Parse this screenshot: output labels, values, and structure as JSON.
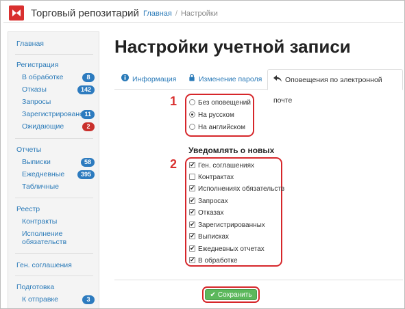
{
  "header": {
    "app_title": "Торговый репозитарий",
    "breadcrumb": [
      {
        "label": "Главная"
      },
      {
        "label": "Настройки"
      }
    ]
  },
  "sidebar": {
    "home": "Главная",
    "registration": "Регистрация",
    "in_processing": {
      "label": "В обработке",
      "count": "8"
    },
    "refusals": {
      "label": "Отказы",
      "count": "142"
    },
    "requests": "Запросы",
    "registered": {
      "label": "Зарегистрировано",
      "count": "11"
    },
    "pending": {
      "label": "Ожидающие",
      "count": "2"
    },
    "reports": "Отчеты",
    "statements": {
      "label": "Выписки",
      "count": "58"
    },
    "daily": {
      "label": "Ежедневные",
      "count": "395"
    },
    "tabular": "Табличные",
    "registry": "Реестр",
    "contracts": "Контракты",
    "execution_line1": "Исполнение",
    "execution_line2": "обязательств",
    "general_agreements": "Ген. соглашения",
    "preparation": "Подготовка",
    "to_send": {
      "label": "К отправке",
      "count": "3"
    }
  },
  "page": {
    "title": "Настройки учетной записи"
  },
  "tabs": [
    {
      "label": "Информация",
      "icon": "info-icon"
    },
    {
      "label": "Изменение пароля",
      "icon": "lock-icon"
    },
    {
      "label": "Оповещения по электронной почте",
      "icon": "reply-arrow-icon",
      "active": true
    }
  ],
  "annotations": {
    "one": "1",
    "two": "2"
  },
  "notification_language": [
    {
      "label": "Без оповещений",
      "selected": false
    },
    {
      "label": "На русском",
      "selected": true
    },
    {
      "label": "На английском",
      "selected": false
    }
  ],
  "notify_heading": "Уведомлять о новых",
  "notify_items": [
    {
      "label": "Ген. соглашениях",
      "checked": true
    },
    {
      "label": "Контрактах",
      "checked": false
    },
    {
      "label": "Исполнениях обязательств",
      "checked": true
    },
    {
      "label": "Запросах",
      "checked": true
    },
    {
      "label": "Отказах",
      "checked": true
    },
    {
      "label": "Зарегистрированных",
      "checked": true
    },
    {
      "label": "Выписках",
      "checked": true
    },
    {
      "label": "Ежедневных отчетах",
      "checked": true
    },
    {
      "label": "В обработке",
      "checked": true
    }
  ],
  "save_label": "Сохранить",
  "colors": {
    "accent": "#2a7ab8",
    "highlight": "#d6262a",
    "badge": "#2d7bbf",
    "badge_alert": "#c9302c",
    "save": "#5cb85c"
  }
}
